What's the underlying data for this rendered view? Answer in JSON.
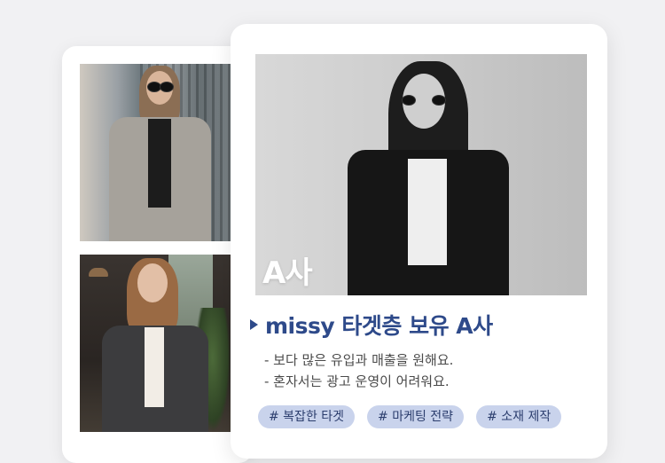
{
  "main": {
    "photo_label": "A사",
    "heading": "missy 타겟층 보유 A사",
    "bullets": [
      "- 보다 많은 유입과 매출을 원해요.",
      "- 혼자서는 광고 운영이 어려워요."
    ],
    "tags": [
      "# 복잡한 타겟",
      "# 마케팅 전략",
      "# 소재 제작"
    ]
  },
  "colors": {
    "accent": "#2e4a8a",
    "tag_bg": "#c9d3ec",
    "background": "#f1f1f3"
  },
  "icons": {
    "heading_marker": "triangle-right-icon"
  }
}
